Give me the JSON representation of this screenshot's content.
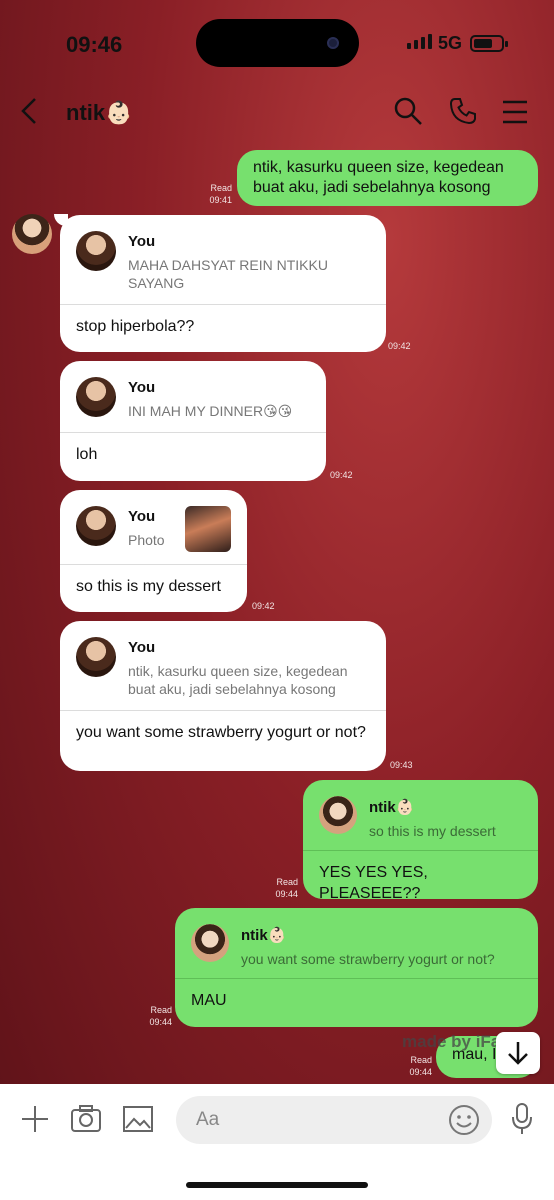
{
  "status": {
    "time": "09:46",
    "network": "5G"
  },
  "header": {
    "contact_name": "ntik👶🏻"
  },
  "messages": [
    {
      "text": "ntik, kasurku queen size, kegedean buat aku, jadi sebelahnya kosong",
      "read": "Read",
      "time": "09:41"
    },
    {
      "quote_name": "You",
      "quote_text": "MAHA DAHSYAT REIN NTIKKU SAYANG",
      "reply": "stop hiperbola??",
      "time": "09:42"
    },
    {
      "quote_name": "You",
      "quote_text": "INI MAH MY DINNER😘😘",
      "reply": "loh",
      "time": "09:42"
    },
    {
      "quote_name": "You",
      "quote_text": "Photo",
      "reply": "so this is my dessert",
      "time": "09:42"
    },
    {
      "quote_name": "You",
      "quote_text": "ntik, kasurku queen size, kegedean buat aku, jadi sebelahnya kosong",
      "reply": "you want some strawberry yogurt or not?",
      "time": "09:43"
    },
    {
      "quote_name": "ntik👶🏻",
      "quote_text": "so this is my dessert",
      "reply": "YES YES YES, PLEASEEE??",
      "read": "Read",
      "time": "09:44"
    },
    {
      "quote_name": "ntik👶🏻",
      "quote_text": "you want some strawberry yogurt or not?",
      "reply": "MAU",
      "read": "Read",
      "time": "09:44"
    },
    {
      "text": "mau, I",
      "read": "Read",
      "time": "09:44"
    }
  ],
  "watermark": "made by iFake",
  "composer": {
    "placeholder": "Aa"
  }
}
